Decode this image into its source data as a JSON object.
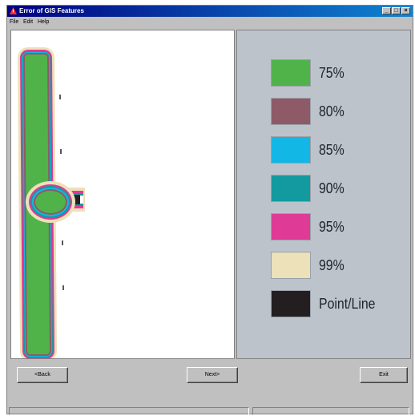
{
  "window": {
    "title": "Error of GIS Features"
  },
  "menu": [
    "File",
    "Edit",
    "Help"
  ],
  "title_controls": [
    "_",
    "□",
    "×"
  ],
  "legend": [
    {
      "label": "75%",
      "color": "#4fb34a"
    },
    {
      "label": "80%",
      "color": "#8e5a67"
    },
    {
      "label": "85%",
      "color": "#12b7e6"
    },
    {
      "label": "90%",
      "color": "#139a9f"
    },
    {
      "label": "95%",
      "color": "#df3a95"
    },
    {
      "label": "99%",
      "color": "#ece1b8"
    },
    {
      "label": "Point/Line",
      "color": "#231f20"
    }
  ],
  "buttons": {
    "back": "<Back",
    "next": "Next>",
    "exit": "Exit"
  }
}
